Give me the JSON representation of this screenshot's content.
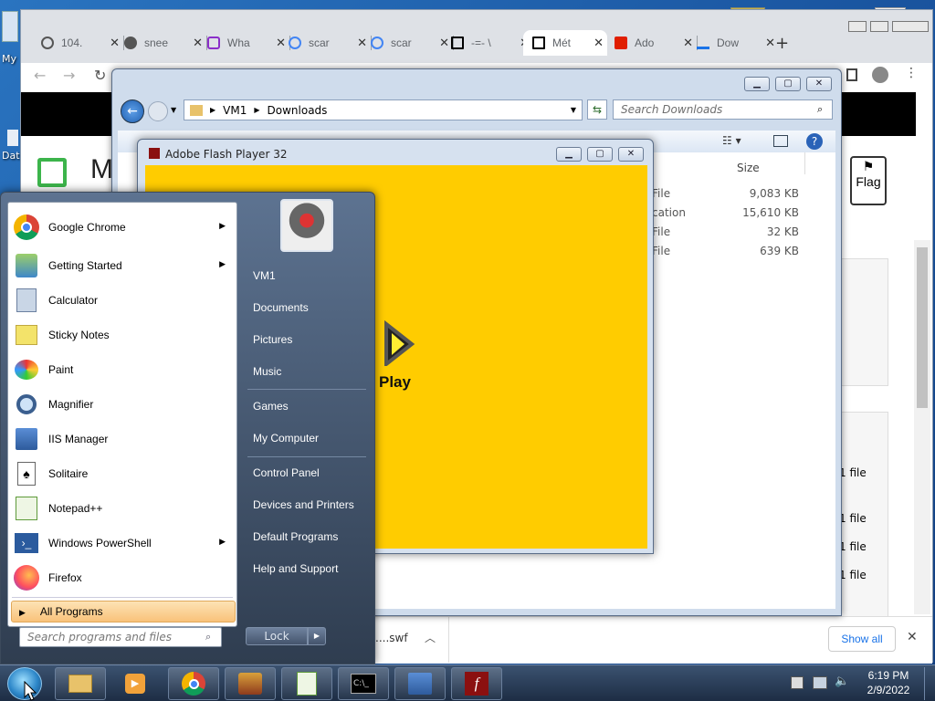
{
  "desktop": {
    "icon_top_label": "My",
    "icon_mid_label": "Dat"
  },
  "chrome": {
    "tabs": [
      {
        "label": "104.",
        "favicon": "globe-icon"
      },
      {
        "label": "snee",
        "favicon": "globe-icon"
      },
      {
        "label": "Wha",
        "favicon": "picsart-icon"
      },
      {
        "label": "scar",
        "favicon": "google-icon"
      },
      {
        "label": "scar",
        "favicon": "google-icon"
      },
      {
        "label": "-=- \\",
        "favicon": "museum-icon"
      },
      {
        "label": "Mét",
        "favicon": "museum-icon"
      },
      {
        "label": "Ado",
        "favicon": "adobe-icon"
      },
      {
        "label": "Dow",
        "favicon": "download-icon"
      }
    ],
    "new_tab": "+",
    "page_heading_partial": "M",
    "flag_label": "Flag",
    "side_texts": [
      "1 file",
      "1 file",
      "1 file",
      "1 file"
    ],
    "download_bar": {
      "file_partial": "....swf",
      "show_all": "Show all",
      "close": "✕"
    }
  },
  "explorer": {
    "breadcrumb": [
      "VM1",
      "Downloads"
    ],
    "search_placeholder": "Search Downloads",
    "column_size": "Size",
    "rows": [
      {
        "type": "File",
        "size": "9,083 KB"
      },
      {
        "type": "cation",
        "size": "15,610 KB"
      },
      {
        "type": "File",
        "size": "32 KB"
      },
      {
        "type": "File",
        "size": "639 KB"
      }
    ]
  },
  "flash": {
    "title": "Adobe Flash Player 32",
    "play_label": "Play",
    "stage_color": "#ffcc00"
  },
  "startmenu": {
    "programs": [
      {
        "label": "Google Chrome",
        "icon": "chrome-icon",
        "submenu": true
      },
      {
        "label": "Getting Started",
        "icon": "getting-started-icon",
        "submenu": true
      },
      {
        "label": "Calculator",
        "icon": "calculator-icon",
        "submenu": false
      },
      {
        "label": "Sticky Notes",
        "icon": "sticky-notes-icon",
        "submenu": false
      },
      {
        "label": "Paint",
        "icon": "paint-icon",
        "submenu": false
      },
      {
        "label": "Magnifier",
        "icon": "magnifier-icon",
        "submenu": false
      },
      {
        "label": "IIS Manager",
        "icon": "iis-manager-icon",
        "submenu": false
      },
      {
        "label": "Solitaire",
        "icon": "solitaire-icon",
        "submenu": false
      },
      {
        "label": "Notepad++",
        "icon": "notepadpp-icon",
        "submenu": false
      },
      {
        "label": "Windows PowerShell",
        "icon": "powershell-icon",
        "submenu": true
      },
      {
        "label": "Firefox",
        "icon": "firefox-icon",
        "submenu": false
      }
    ],
    "all_programs": "All Programs",
    "search_placeholder": "Search programs and files",
    "right_items": [
      "VM1",
      "Documents",
      "Pictures",
      "Music",
      "Games",
      "My Computer",
      "Control Panel",
      "Devices and Printers",
      "Default Programs",
      "Help and Support"
    ],
    "lock_label": "Lock"
  },
  "taskbar": {
    "time": "6:19 PM",
    "date": "2/9/2022"
  }
}
